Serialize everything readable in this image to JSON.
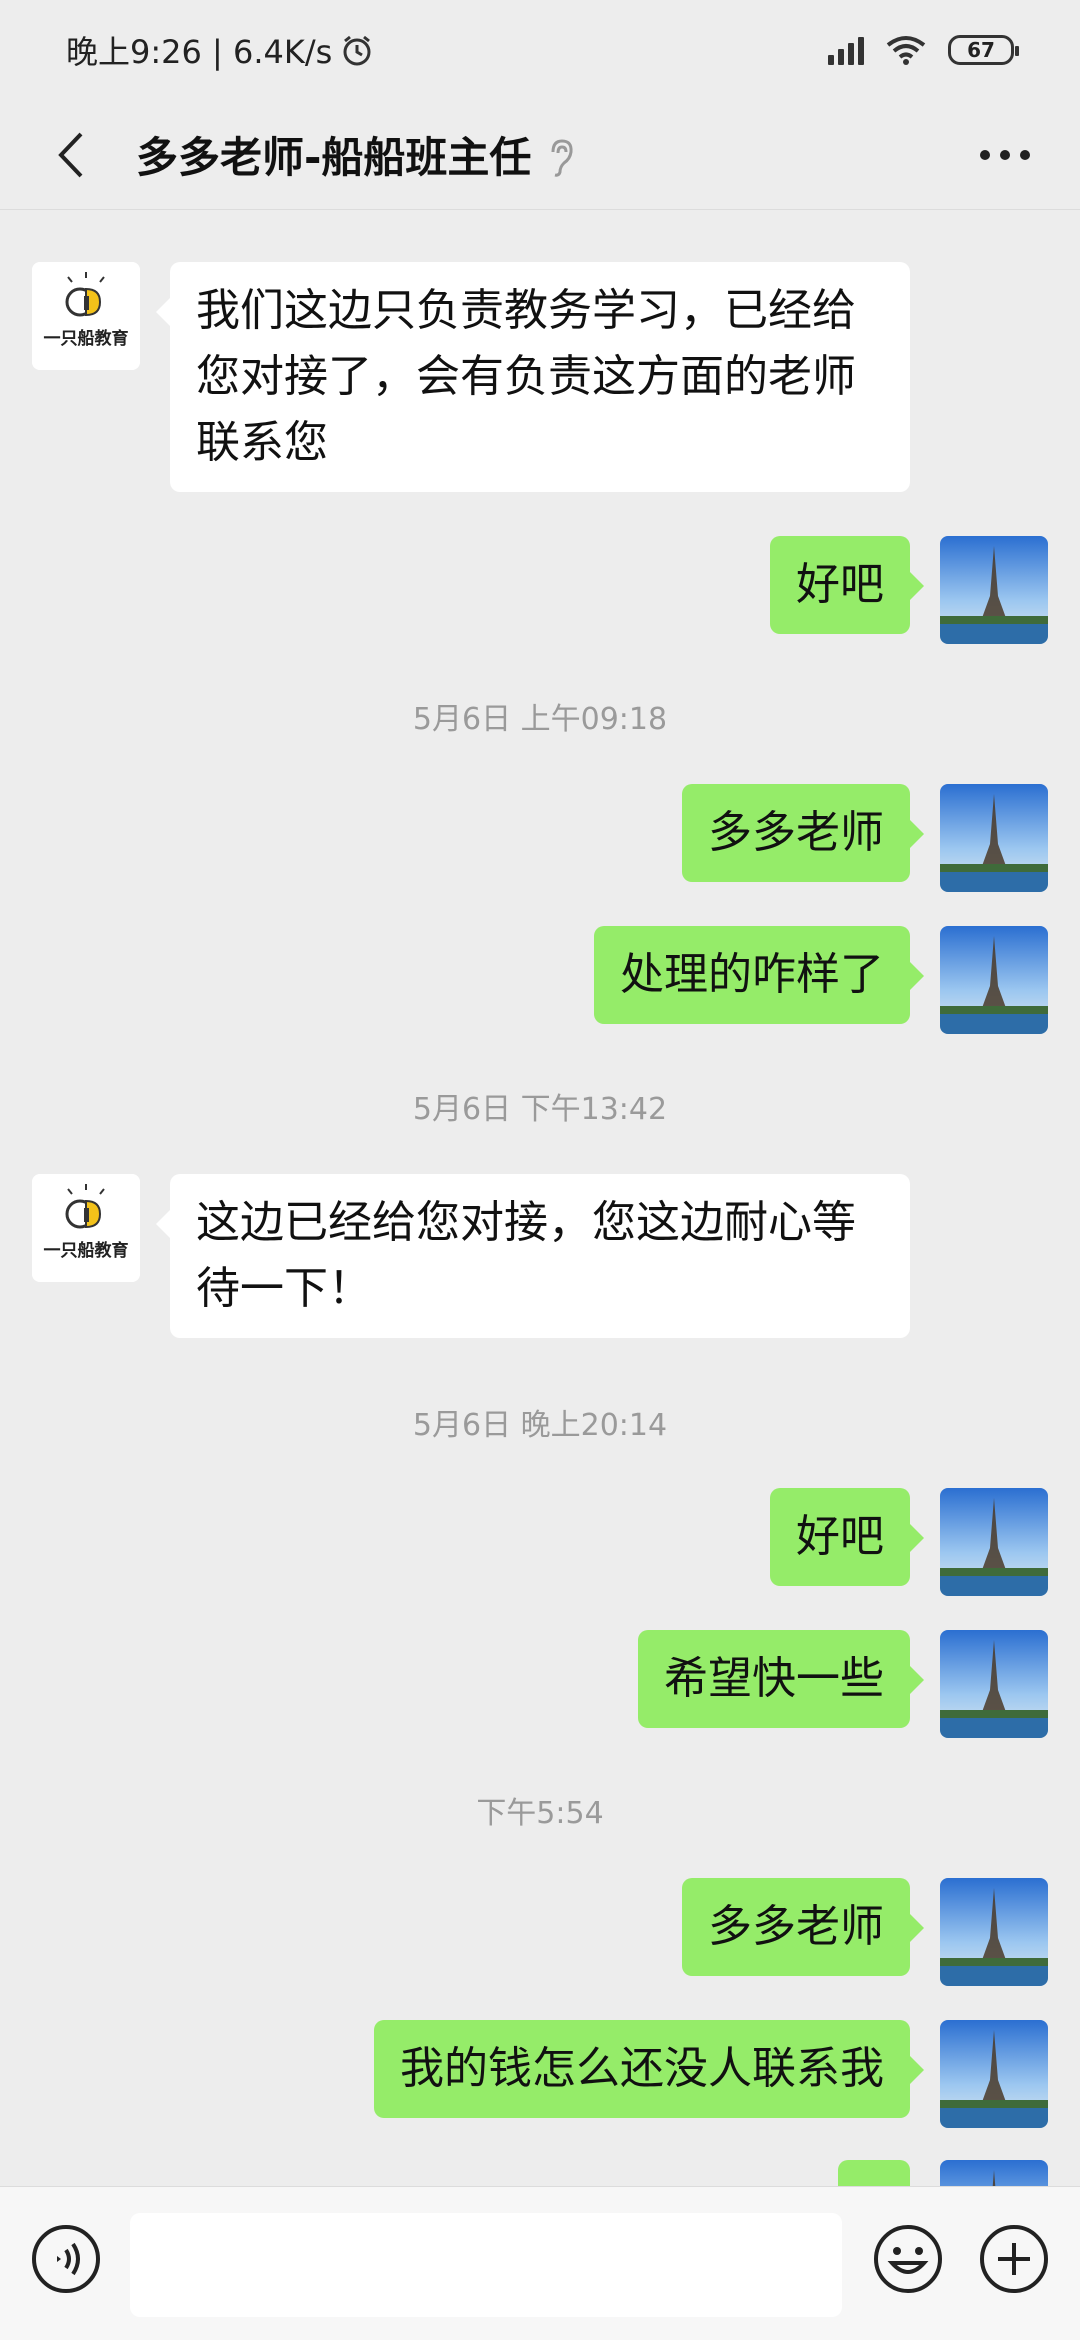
{
  "status_bar": {
    "time_speed": "晚上9:26 | 6.4K/s",
    "battery": "67"
  },
  "header": {
    "title": "多多老师-船船班主任"
  },
  "contact_avatar": {
    "logo_text": "一只船教育"
  },
  "messages": [
    {
      "type": "in",
      "text": "我们这边只负责教务学习，已经给您对接了，会有负责这方面的老师联系您"
    },
    {
      "type": "out",
      "text": "好吧"
    },
    {
      "type": "time",
      "text": "5月6日 上午09:18"
    },
    {
      "type": "out",
      "text": "多多老师"
    },
    {
      "type": "out",
      "text": "处理的咋样了"
    },
    {
      "type": "time",
      "text": "5月6日 下午13:42"
    },
    {
      "type": "in",
      "text": "这边已经给您对接，您这边耐心等待一下！"
    },
    {
      "type": "time",
      "text": "5月6日 晚上20:14"
    },
    {
      "type": "out",
      "text": "好吧"
    },
    {
      "type": "out",
      "text": "希望快一些"
    },
    {
      "type": "time",
      "text": "下午5:54"
    },
    {
      "type": "out",
      "text": "多多老师"
    },
    {
      "type": "out",
      "text": "我的钱怎么还没人联系我"
    },
    {
      "type": "out",
      "text": ""
    }
  ],
  "input": {
    "value": ""
  },
  "icons": {
    "back": "back-arrow-icon",
    "ear": "ear-icon",
    "more": "more-dots-icon",
    "voice": "voice-icon",
    "emoji": "emoji-icon",
    "plus": "plus-icon"
  },
  "colors": {
    "outgoing_bubble": "#95ec69",
    "incoming_bubble": "#ffffff",
    "background": "#ededed"
  }
}
